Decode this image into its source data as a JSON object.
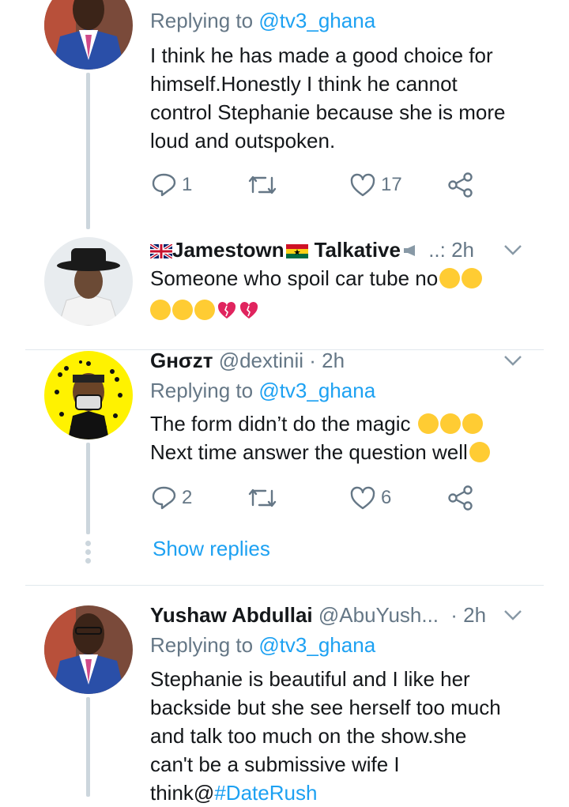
{
  "tweets": [
    {
      "replying_label": "Replying to",
      "replying_handle": "@tv3_ghana",
      "lines": [
        "I think he has made a good choice for",
        "himself.Honestly I think he cannot",
        "control Stephanie because she is more",
        "loud and outspoken."
      ],
      "reply_count": "1",
      "like_count": "17"
    },
    {
      "name": "Jamestown",
      "name2": "Talkative",
      "handle_and_time": "..: 2h",
      "line1": "Someone who spoil car tube no"
    },
    {
      "name": "Gнσzт",
      "handle": "@dextinii",
      "time": "· 2h",
      "replying_label": "Replying to",
      "replying_handle": "@tv3_ghana",
      "line1": "The form didn’t do the magic",
      "line2": "Next time answer the question well",
      "reply_count": "2",
      "like_count": "6",
      "show_replies": "Show replies"
    },
    {
      "name": "Yushaw Abdullai",
      "handle": "@AbuYush...",
      "time": "· 2h",
      "replying_label": "Replying to",
      "replying_handle": "@tv3_ghana",
      "lines": [
        "Stephanie is beautiful and I like her",
        "backside but she see herself too much",
        "and talk too much on the show.she",
        "can't be a submissive wife I"
      ],
      "last_line_prefix": "think@",
      "hashtag": "#DateRush"
    }
  ],
  "colors": {
    "accent": "#1da1f2",
    "secondary": "#657786",
    "thread": "#ccd6dd",
    "divider": "#e1e8ed"
  },
  "icons": [
    "reply-icon",
    "retweet-icon",
    "like-icon",
    "share-icon",
    "chevron-down-icon"
  ]
}
